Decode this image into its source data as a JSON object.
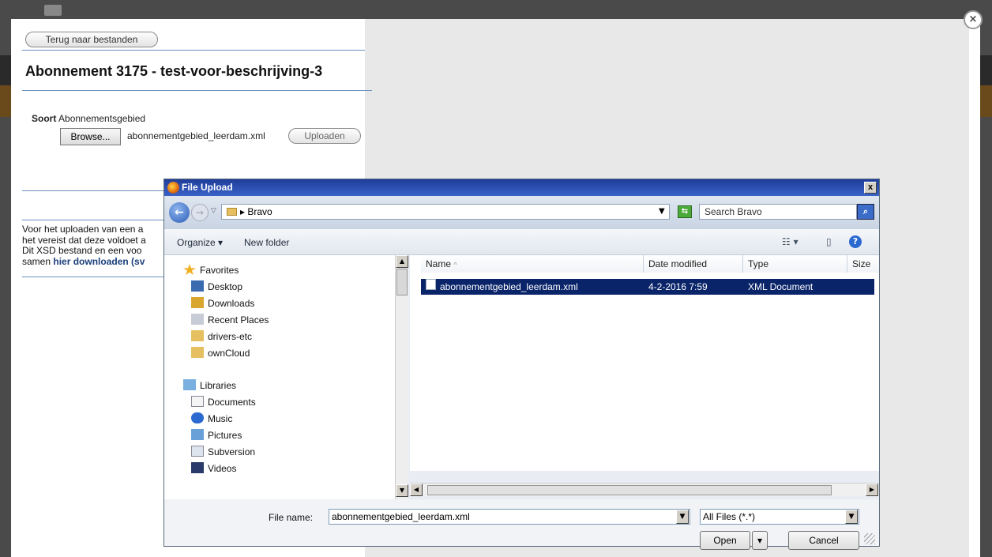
{
  "page": {
    "back_label": "Terug naar bestanden",
    "title": "Abonnement 3175 - test-voor-beschrijving-3",
    "soort_label": "Soort",
    "soort_value": "Abonnementsgebied",
    "browse_label": "Browse...",
    "chosen_file": "abonnementgebied_leerdam.xml",
    "upload_label": "Uploaden",
    "info_line1": "Voor het uploaden van een a",
    "info_line2": "het vereist dat deze voldoet a",
    "info_line3": "Dit XSD bestand en een voo",
    "info_line4_prefix": "samen ",
    "info_line4_link": "hier downloaden (sv"
  },
  "dialog": {
    "title": "File Upload",
    "close": "x",
    "path": "Bravo",
    "search_placeholder": "Search Bravo",
    "organize": "Organize",
    "new_folder": "New folder",
    "nav": {
      "favorites": "Favorites",
      "fav_items": [
        "Desktop",
        "Downloads",
        "Recent Places",
        "drivers-etc",
        "ownCloud"
      ],
      "libraries": "Libraries",
      "lib_items": [
        "Documents",
        "Music",
        "Pictures",
        "Subversion",
        "Videos"
      ]
    },
    "columns": [
      "Name",
      "Date modified",
      "Type",
      "Size"
    ],
    "files": [
      {
        "name": "abonnementgebied_leerdam.xml",
        "date": "4-2-2016 7:59",
        "type": "XML Document"
      }
    ],
    "file_name_label": "File name:",
    "file_name_value": "abonnementgebied_leerdam.xml",
    "file_type": "All Files (*.*)",
    "open_label": "Open",
    "cancel_label": "Cancel"
  },
  "icons": {
    "modal_close": "close-icon",
    "back": "back-arrow-icon",
    "forward": "forward-arrow-icon",
    "refresh": "refresh-icon",
    "search": "search-icon",
    "help": "help-icon"
  },
  "colors": {
    "selection": "#0a246a",
    "titlebar": "#2a4ab0",
    "link": "#1a3e7a"
  }
}
